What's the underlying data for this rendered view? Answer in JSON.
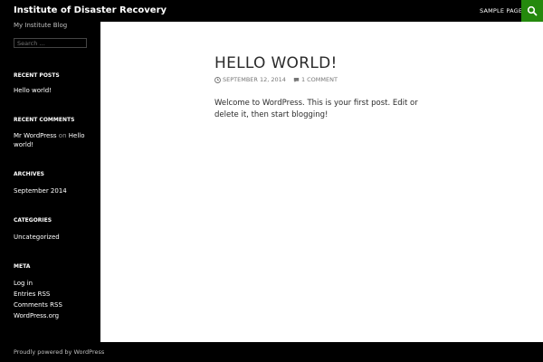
{
  "header": {
    "site_title": "Institute of Disaster Recovery",
    "nav_item": "Sample Page",
    "accent_color": "#24890d"
  },
  "sidebar": {
    "tagline": "My Institute Blog",
    "search_placeholder": "Search …",
    "recent_posts_title": "Recent Posts",
    "recent_posts": [
      "Hello world!"
    ],
    "recent_comments_title": "Recent Comments",
    "recent_comment": {
      "author": "Mr WordPress",
      "on": "on",
      "post": "Hello world!"
    },
    "archives_title": "Archives",
    "archives": [
      "September 2014"
    ],
    "categories_title": "Categories",
    "categories": [
      "Uncategorized"
    ],
    "meta_title": "Meta",
    "meta_links": [
      "Log in",
      "Entries RSS",
      "Comments RSS",
      "WordPress.org"
    ]
  },
  "post": {
    "title": "HELLO WORLD!",
    "date": "September 12, 2014",
    "comments": "1 Comment",
    "body": "Welcome to WordPress. This is your first post. Edit or delete it, then start blogging!"
  },
  "footer": {
    "text": "Proudly powered by WordPress"
  }
}
